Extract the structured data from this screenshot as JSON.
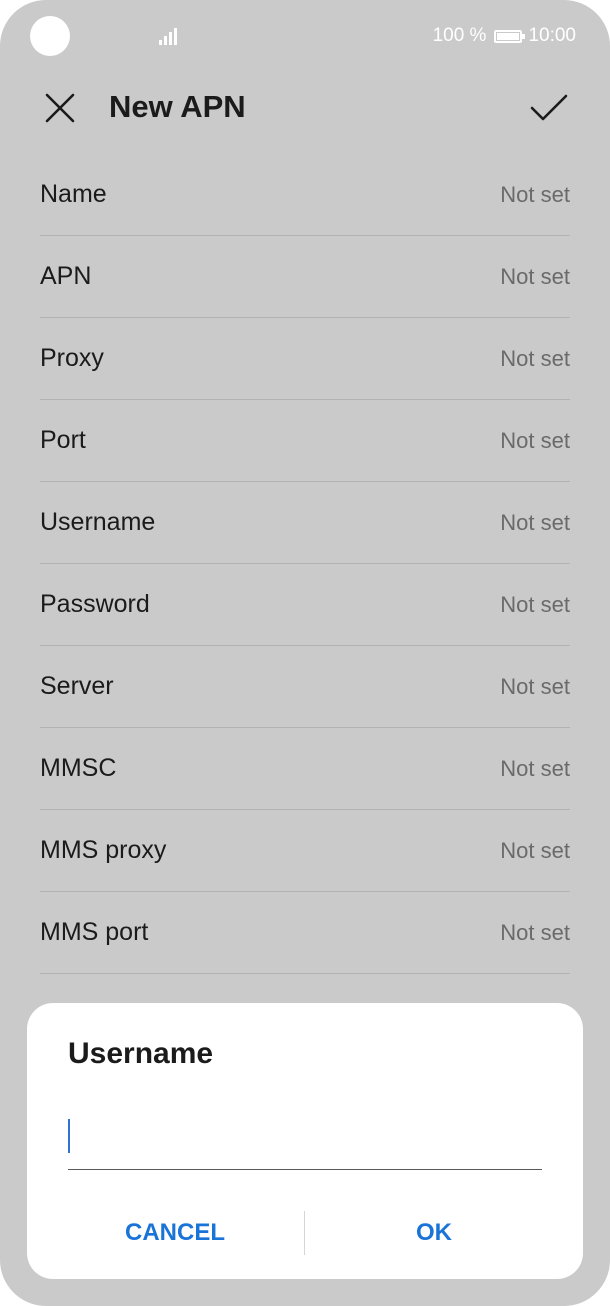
{
  "status_bar": {
    "battery_percent": "100 %",
    "time": "10:00",
    "icons": [
      "camera-cutout",
      "signal-icon",
      "battery-icon"
    ]
  },
  "header": {
    "title": "New APN",
    "close_icon": "close-icon",
    "confirm_icon": "check-icon"
  },
  "apn_fields": [
    {
      "label": "Name",
      "value": "Not set"
    },
    {
      "label": "APN",
      "value": "Not set"
    },
    {
      "label": "Proxy",
      "value": "Not set"
    },
    {
      "label": "Port",
      "value": "Not set"
    },
    {
      "label": "Username",
      "value": "Not set"
    },
    {
      "label": "Password",
      "value": "Not set"
    },
    {
      "label": "Server",
      "value": "Not set"
    },
    {
      "label": "MMSC",
      "value": "Not set"
    },
    {
      "label": "MMS proxy",
      "value": "Not set"
    },
    {
      "label": "MMS port",
      "value": "Not set"
    }
  ],
  "dialog": {
    "title": "Username",
    "input_value": "",
    "cancel_label": "CANCEL",
    "ok_label": "OK"
  },
  "colors": {
    "overlay_bg": "#cacaca",
    "accent": "#1a74d8",
    "caret": "#2f72d6"
  }
}
